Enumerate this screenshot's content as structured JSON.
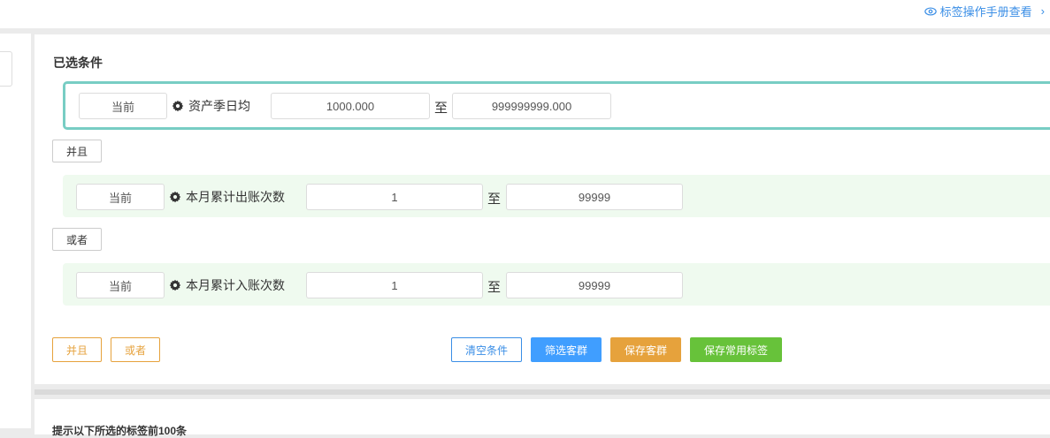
{
  "header": {
    "manual_link": "标签操作手册查看",
    "manual_icon": "eye-icon",
    "overflow_glyph": "›"
  },
  "section": {
    "title": "已选条件"
  },
  "conditions": [
    {
      "period": "当前",
      "label": "资产季日均",
      "from": "1000.000",
      "to_word": "至",
      "to": "999999999.000"
    },
    {
      "period": "当前",
      "label": "本月累计出账次数",
      "from": "1",
      "to_word": "至",
      "to": "99999"
    },
    {
      "period": "当前",
      "label": "本月累计入账次数",
      "from": "1",
      "to_word": "至",
      "to": "99999"
    }
  ],
  "logic": {
    "first": "并且",
    "second": "或者"
  },
  "actions": {
    "add_and": "并且",
    "add_or": "或者",
    "clear": "清空条件",
    "filter": "筛选客群",
    "save_group": "保存客群",
    "save_tag": "保存常用标签"
  },
  "colors": {
    "accent_blue": "#409eff",
    "orange": "#e6a23c",
    "green": "#67c23a",
    "teal_border": "#78cdc4"
  },
  "bottom": {
    "partial_text": "提示以下所选的标签前100条"
  }
}
